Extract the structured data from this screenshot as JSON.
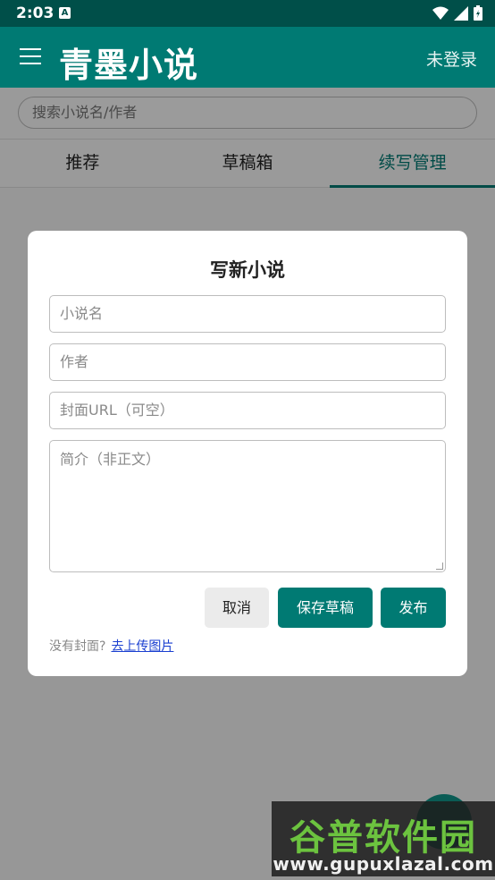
{
  "status_bar": {
    "time": "2:03",
    "notif_letter": "A"
  },
  "app_bar": {
    "title": "青墨小说",
    "login_label": "未登录"
  },
  "search": {
    "placeholder": "搜索小说名/作者"
  },
  "tabs": [
    {
      "label": "推荐"
    },
    {
      "label": "草稿箱"
    },
    {
      "label": "续写管理"
    }
  ],
  "dialog": {
    "title": "写新小说",
    "fields": {
      "name_placeholder": "小说名",
      "author_placeholder": "作者",
      "cover_placeholder": "封面URL（可空）",
      "intro_placeholder": "简介（非正文）"
    },
    "buttons": {
      "cancel": "取消",
      "save_draft": "保存草稿",
      "publish": "发布"
    },
    "hint_text": "没有封面?",
    "hint_link": "去上传图片"
  },
  "watermark": {
    "brand": "谷普软件园",
    "url": "www.gupuxlazal.com"
  },
  "colors": {
    "primary": "#007a73",
    "status_bar": "#004f49",
    "link": "#1a3fd0"
  }
}
